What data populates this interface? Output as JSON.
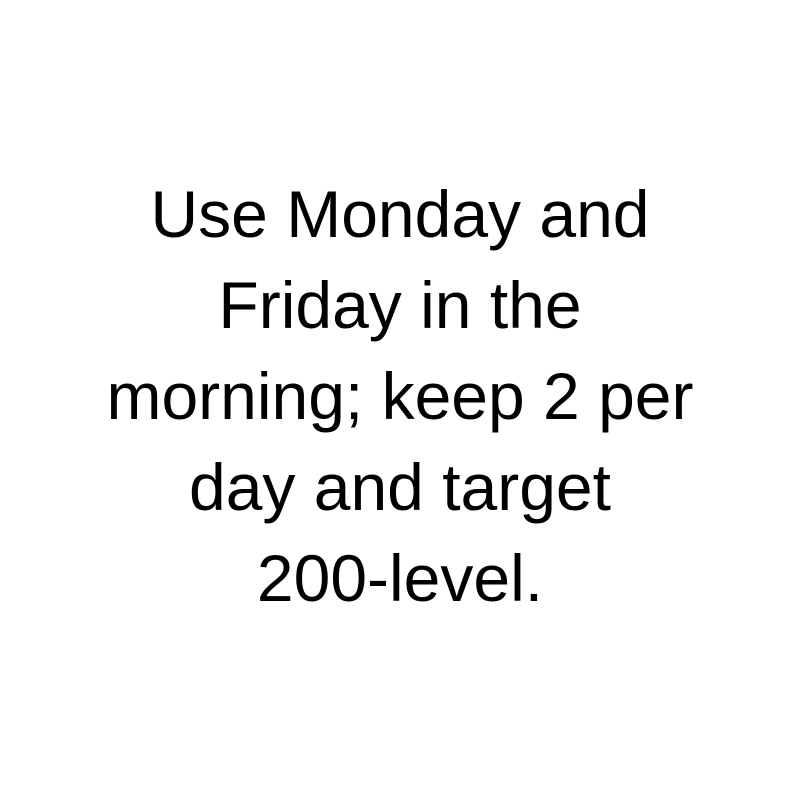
{
  "note": {
    "lines": [
      "Use Monday and",
      "Friday in the",
      "morning; keep 2 per",
      "day and target",
      "200-level."
    ]
  },
  "colors": {
    "background": "#ffffff",
    "text": "#000000"
  }
}
